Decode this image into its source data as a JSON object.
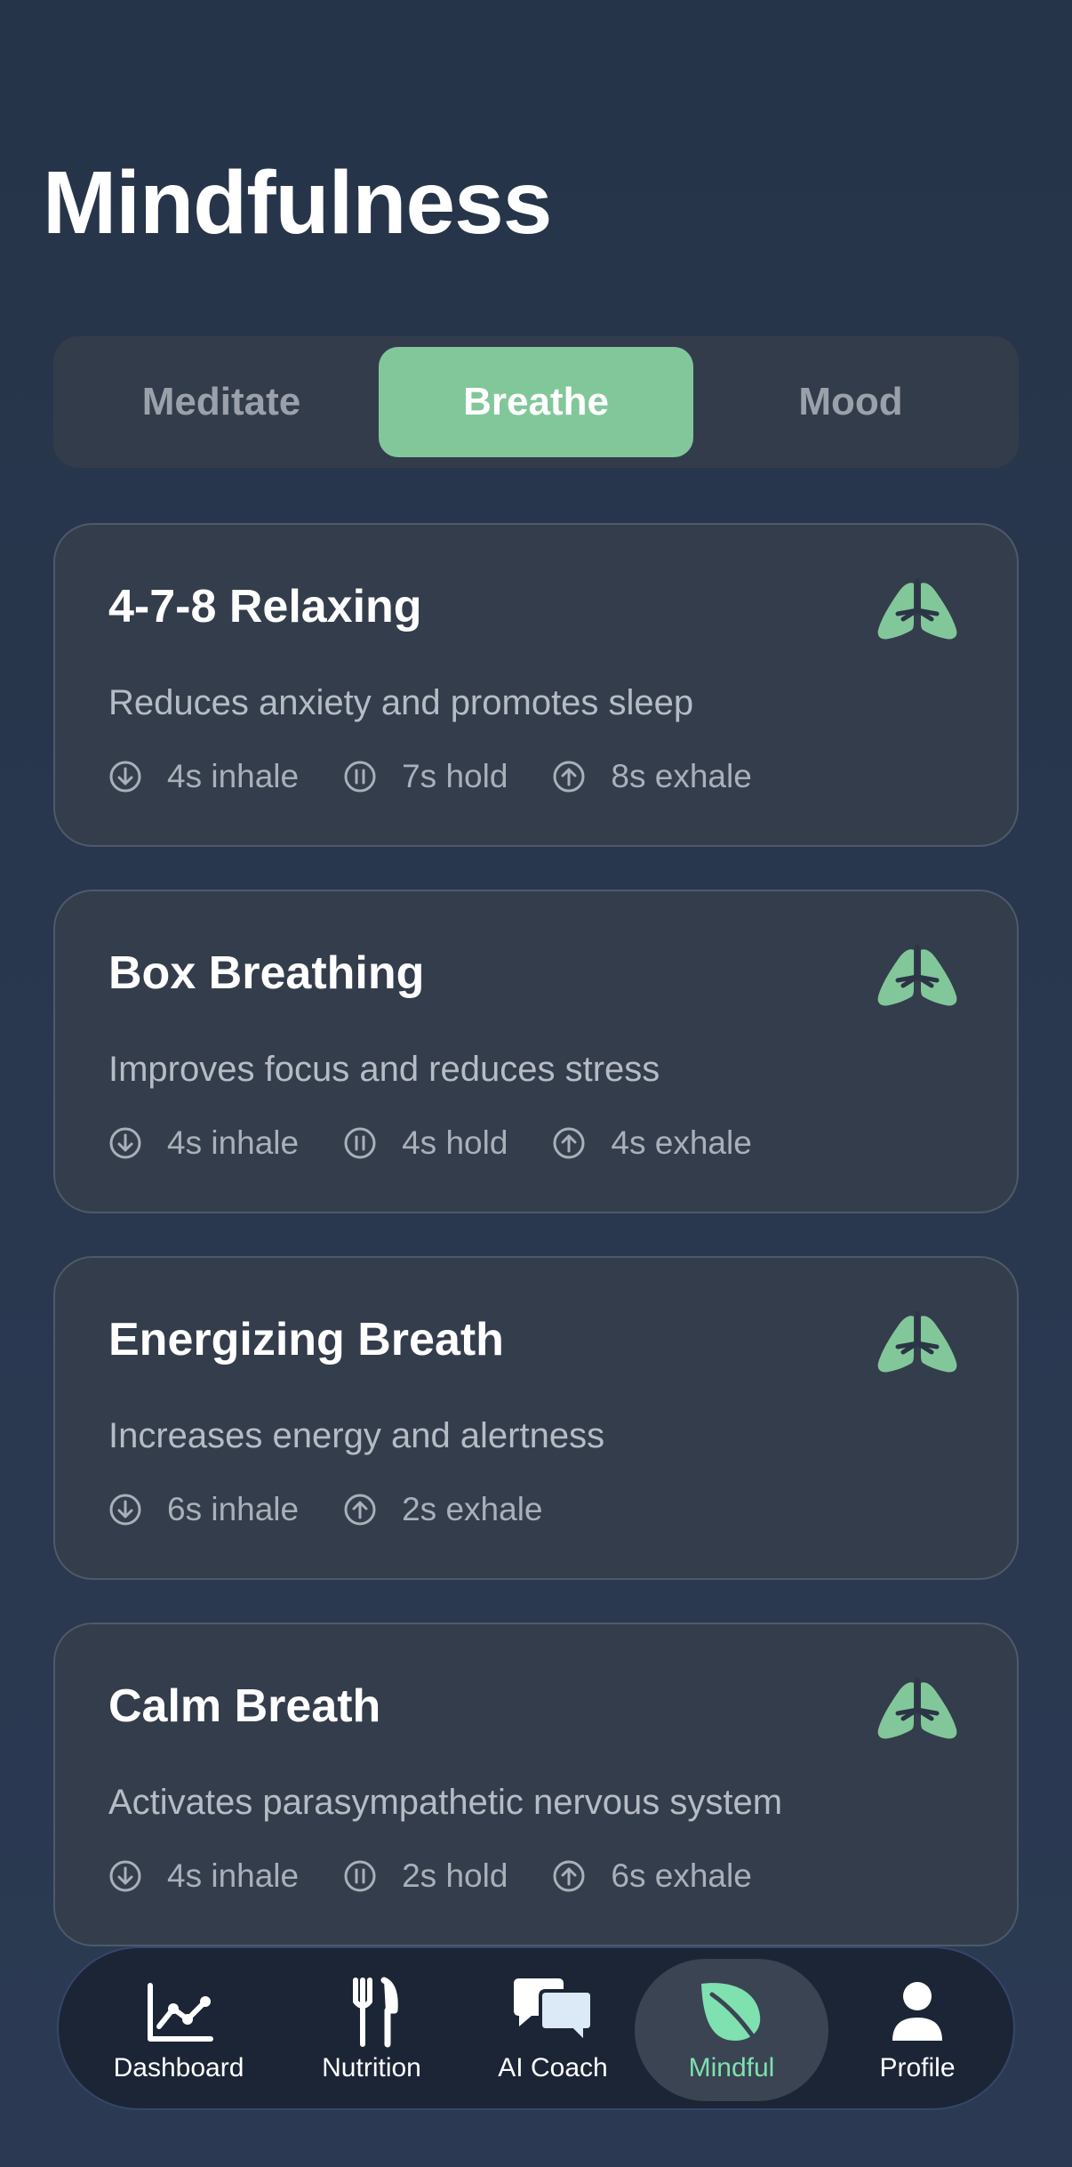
{
  "page": {
    "title": "Mindfulness"
  },
  "segments": [
    {
      "label": "Meditate",
      "active": false
    },
    {
      "label": "Breathe",
      "active": true
    },
    {
      "label": "Mood",
      "active": false
    }
  ],
  "exercises": [
    {
      "title": "4-7-8 Relaxing",
      "description": "Reduces anxiety and promotes sleep",
      "phases": [
        {
          "type": "inhale",
          "icon": "arrow-down-circle-icon",
          "label": "4s inhale"
        },
        {
          "type": "hold",
          "icon": "pause-circle-icon",
          "label": "7s hold"
        },
        {
          "type": "exhale",
          "icon": "arrow-up-circle-icon",
          "label": "8s exhale"
        }
      ]
    },
    {
      "title": "Box Breathing",
      "description": "Improves focus and reduces stress",
      "phases": [
        {
          "type": "inhale",
          "icon": "arrow-down-circle-icon",
          "label": "4s inhale"
        },
        {
          "type": "hold",
          "icon": "pause-circle-icon",
          "label": "4s hold"
        },
        {
          "type": "exhale",
          "icon": "arrow-up-circle-icon",
          "label": "4s exhale"
        }
      ]
    },
    {
      "title": "Energizing Breath",
      "description": "Increases energy and alertness",
      "phases": [
        {
          "type": "inhale",
          "icon": "arrow-down-circle-icon",
          "label": "6s inhale"
        },
        {
          "type": "exhale",
          "icon": "arrow-up-circle-icon",
          "label": "2s exhale"
        }
      ]
    },
    {
      "title": "Calm Breath",
      "description": "Activates parasympathetic nervous system",
      "phases": [
        {
          "type": "inhale",
          "icon": "arrow-down-circle-icon",
          "label": "4s inhale"
        },
        {
          "type": "hold",
          "icon": "pause-circle-icon",
          "label": "2s hold"
        },
        {
          "type": "exhale",
          "icon": "arrow-up-circle-icon",
          "label": "6s exhale"
        }
      ]
    }
  ],
  "tabbar": [
    {
      "label": "Dashboard",
      "icon": "chart-line-icon",
      "active": false
    },
    {
      "label": "Nutrition",
      "icon": "fork-knife-icon",
      "active": false
    },
    {
      "label": "AI Coach",
      "icon": "chat-bubbles-icon",
      "active": false
    },
    {
      "label": "Mindful",
      "icon": "leaf-icon",
      "active": true
    },
    {
      "label": "Profile",
      "icon": "person-icon",
      "active": false
    }
  ],
  "colors": {
    "accent": "#82c79a",
    "accent_text": "#7fe0b0",
    "background": "#263449",
    "card": "#343d4b"
  }
}
